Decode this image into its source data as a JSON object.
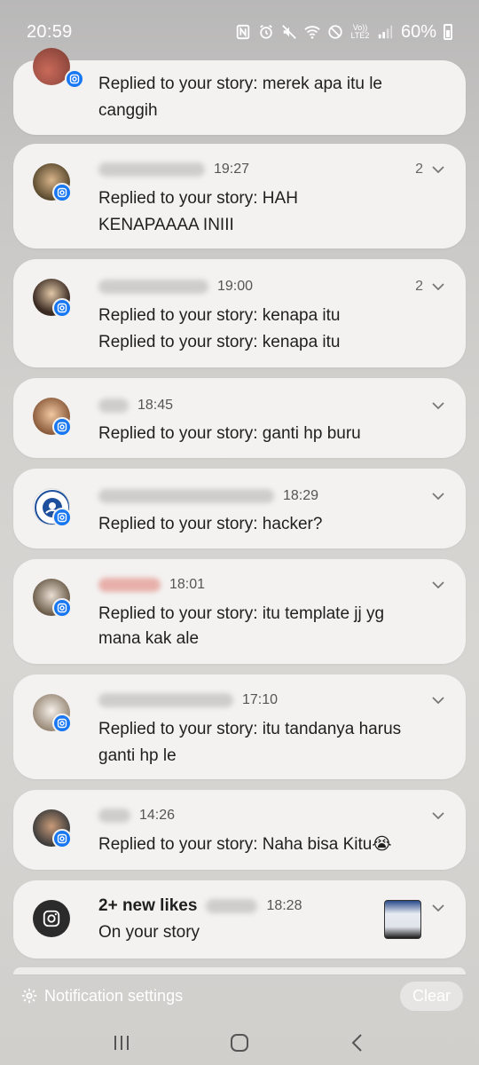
{
  "status_bar": {
    "time": "20:59",
    "battery": "60%",
    "icons": [
      "nfc-icon",
      "alarm-icon",
      "mute-icon",
      "wifi-icon",
      "dnd-icon",
      "volte-icon",
      "signal-icon",
      "battery-icon"
    ],
    "network_label": "Vo)) LTE2"
  },
  "notifications": [
    {
      "sender": "",
      "time": "",
      "count": "",
      "lines": [
        "Replied to your story: merek apa itu le",
        "canggih"
      ]
    },
    {
      "sender": "",
      "time": "19:27",
      "count": "2",
      "lines": [
        "Replied to your story: HAH",
        "KENAPAAAA INIII"
      ]
    },
    {
      "sender": "",
      "time": "19:00",
      "count": "2",
      "lines": [
        "Replied to your story: kenapa itu",
        "Replied to your story: kenapa itu"
      ]
    },
    {
      "sender": "",
      "time": "18:45",
      "count": "",
      "lines": [
        "Replied to your story: ganti hp buru"
      ]
    },
    {
      "sender": "",
      "time": "18:29",
      "count": "",
      "lines": [
        "Replied to your story: hacker?"
      ]
    },
    {
      "sender": "",
      "time": "18:01",
      "count": "",
      "lines": [
        "Replied to your story: itu template jj yg",
        "mana kak ale"
      ]
    },
    {
      "sender": "",
      "time": "17:10",
      "count": "",
      "lines": [
        "Replied to your story: itu tandanya harus",
        "ganti hp le"
      ]
    },
    {
      "sender": "",
      "time": "14:26",
      "count": "",
      "lines": [
        "Replied to your story: Naha bisa Kitu😭"
      ]
    },
    {
      "title": "2+ new likes",
      "time": "18:28",
      "body": "On your story"
    }
  ],
  "footer": {
    "settings_label": "Notification settings",
    "clear_label": "Clear"
  },
  "colors": {
    "card_bg": "#f3f2f1",
    "instagram_badge": "#1877f2"
  }
}
